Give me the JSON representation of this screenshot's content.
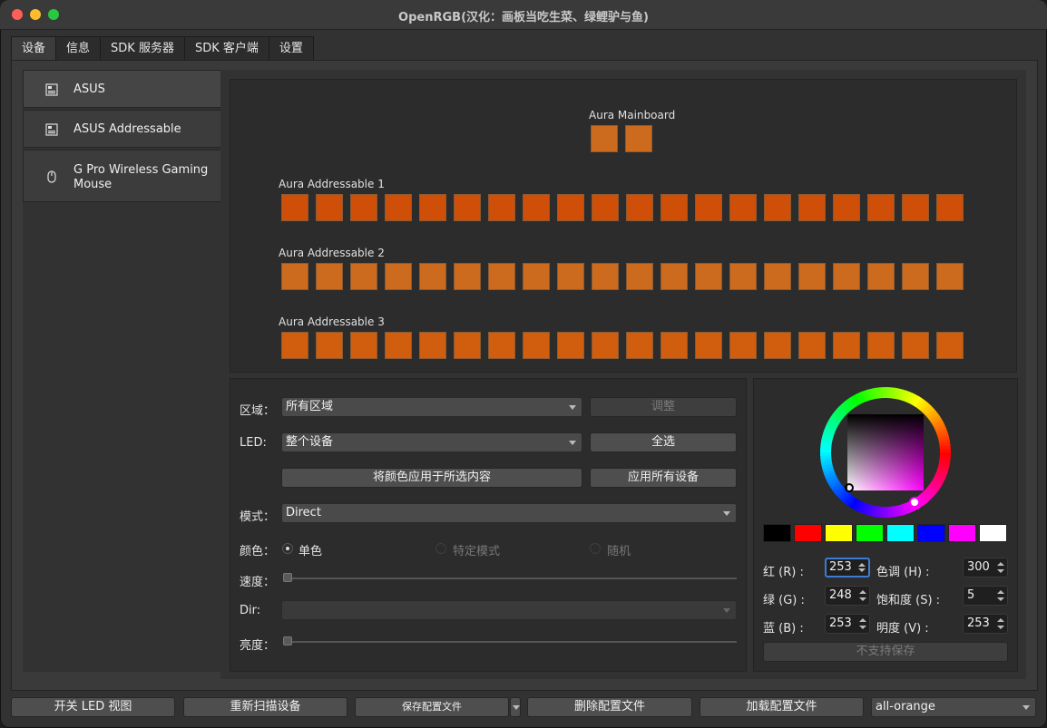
{
  "window": {
    "title": "OpenRGB(汉化：画板当吃生菜、绿鲤驴与鱼)"
  },
  "tabs": [
    {
      "label": "设备",
      "active": true
    },
    {
      "label": "信息"
    },
    {
      "label": "SDK 服务器"
    },
    {
      "label": "SDK 客户端"
    },
    {
      "label": "设置"
    }
  ],
  "devices": [
    {
      "name": "ASUS",
      "icon": "motherboard-icon"
    },
    {
      "name": "ASUS  Addressable",
      "icon": "motherboard-icon"
    },
    {
      "name": "G Pro Wireless Gaming Mouse",
      "icon": "mouse-icon"
    }
  ],
  "zones": [
    {
      "label": "Aura Mainboard",
      "count": 2,
      "color": "#cc6b1e"
    },
    {
      "label": "Aura Addressable 1",
      "count": 20,
      "color": "#d04f08"
    },
    {
      "label": "Aura Addressable 2",
      "count": 20,
      "color": "#cc6b1e"
    },
    {
      "label": "Aura Addressable 3",
      "count": 20,
      "color": "#d05e0e"
    }
  ],
  "controls": {
    "zone_label": "区域：",
    "zone_value": "所有区域",
    "adjust_button": "调整",
    "led_label": "LED:",
    "led_value": "整个设备",
    "select_all_button": "全选",
    "apply_selected_button": "将颜色应用于所选内容",
    "apply_all_button": "应用所有设备",
    "mode_label": "模式：",
    "mode_value": "Direct",
    "color_label": "颜色：",
    "radio_single": "单色",
    "radio_mode_specific": "特定模式",
    "radio_random": "随机",
    "speed_label": "速度：",
    "dir_label": "Dir:",
    "dir_value": "",
    "brightness_label": "亮度："
  },
  "color": {
    "swatches": [
      "#000000",
      "#ff0000",
      "#ffff00",
      "#00ff00",
      "#00ffff",
      "#0000ff",
      "#ff00ff",
      "#ffffff"
    ],
    "red_label": "红 (R) :",
    "red_value": "253",
    "green_label": "绿 (G) :",
    "green_value": "248",
    "blue_label": "蓝 (B) :",
    "blue_value": "253",
    "hue_label": "色调 (H) :",
    "hue_value": "300",
    "sat_label": "饱和度 (S) :",
    "sat_value": "5",
    "val_label": "明度 (V) :",
    "val_value": "253",
    "save_button": "不支持保存"
  },
  "bottom": {
    "toggle_led_view": "开关 LED 视图",
    "rescan": "重新扫描设备",
    "save_profile": "保存配置文件",
    "delete_profile": "删除配置文件",
    "load_profile": "加载配置文件",
    "profile_value": "all-orange"
  }
}
